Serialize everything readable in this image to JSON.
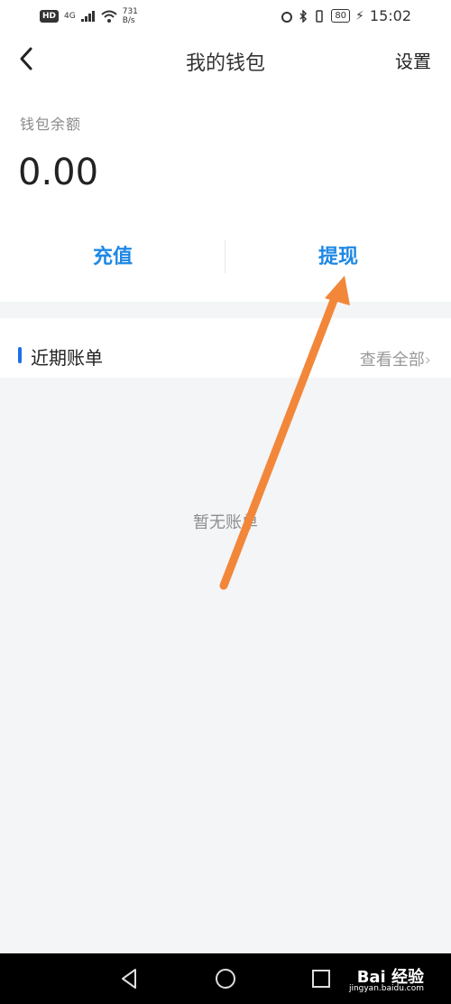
{
  "status_bar": {
    "hd": "HD",
    "signal": "4G",
    "speed_value": "731",
    "speed_unit": "B/s",
    "battery": "80",
    "time": "15:02"
  },
  "header": {
    "title": "我的钱包",
    "settings_label": "设置"
  },
  "wallet": {
    "balance_label": "钱包余额",
    "balance_value": "0.00",
    "recharge_label": "充值",
    "withdraw_label": "提现"
  },
  "bills": {
    "title": "近期账单",
    "view_all_label": "查看全部",
    "empty_text": "暂无账单"
  },
  "watermark": {
    "brand": "Bai 经验",
    "domain": "jingyan.baidu.com"
  },
  "colors": {
    "accent": "#1e88e5",
    "annotation_arrow": "#f2873a"
  }
}
